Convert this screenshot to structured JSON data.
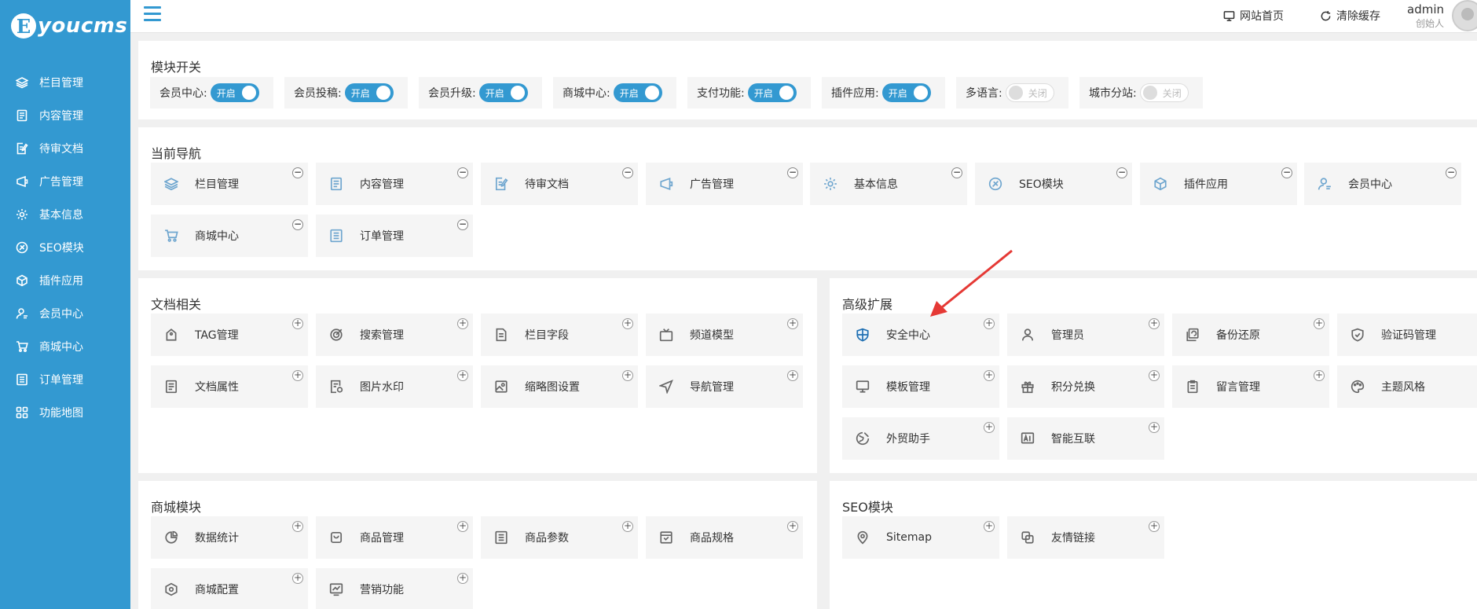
{
  "logo": {
    "letter": "E",
    "text": "youcms"
  },
  "sidebar": {
    "items": [
      {
        "label": "栏目管理",
        "icon": "layers-icon"
      },
      {
        "label": "内容管理",
        "icon": "document-icon"
      },
      {
        "label": "待审文档",
        "icon": "edit-document-icon"
      },
      {
        "label": "广告管理",
        "icon": "ad-icon"
      },
      {
        "label": "基本信息",
        "icon": "gear-icon"
      },
      {
        "label": "SEO模块",
        "icon": "seo-icon"
      },
      {
        "label": "插件应用",
        "icon": "cube-icon"
      },
      {
        "label": "会员中心",
        "icon": "user-icon"
      },
      {
        "label": "商城中心",
        "icon": "cart-icon"
      },
      {
        "label": "订单管理",
        "icon": "list-icon"
      },
      {
        "label": "功能地图",
        "icon": "grid-icon"
      }
    ]
  },
  "topbar": {
    "home_label": "网站首页",
    "clear_cache_label": "清除缓存",
    "user_name": "admin",
    "user_role": "创始人"
  },
  "modules": {
    "title": "模块开关",
    "toggles": [
      {
        "label": "会员中心:",
        "state": "开启",
        "on": true
      },
      {
        "label": "会员投稿:",
        "state": "开启",
        "on": true
      },
      {
        "label": "会员升级:",
        "state": "开启",
        "on": true
      },
      {
        "label": "商城中心:",
        "state": "开启",
        "on": true
      },
      {
        "label": "支付功能:",
        "state": "开启",
        "on": true
      },
      {
        "label": "插件应用:",
        "state": "开启",
        "on": true
      },
      {
        "label": "多语言:",
        "state": "关闭",
        "on": false
      },
      {
        "label": "城市分站:",
        "state": "关闭",
        "on": false
      }
    ]
  },
  "current_nav": {
    "title": "当前导航",
    "items": [
      {
        "label": "栏目管理",
        "icon": "layers-icon"
      },
      {
        "label": "内容管理",
        "icon": "document-icon"
      },
      {
        "label": "待审文档",
        "icon": "edit-document-icon"
      },
      {
        "label": "广告管理",
        "icon": "ad-icon"
      },
      {
        "label": "基本信息",
        "icon": "gear-icon"
      },
      {
        "label": "SEO模块",
        "icon": "seo-icon"
      },
      {
        "label": "插件应用",
        "icon": "cube-icon"
      },
      {
        "label": "会员中心",
        "icon": "user-icon"
      },
      {
        "label": "商城中心",
        "icon": "cart-icon"
      },
      {
        "label": "订单管理",
        "icon": "list-icon"
      }
    ]
  },
  "doc_related": {
    "title": "文档相关",
    "items": [
      {
        "label": "TAG管理",
        "icon": "tag-icon"
      },
      {
        "label": "搜索管理",
        "icon": "search-target-icon"
      },
      {
        "label": "栏目字段",
        "icon": "field-icon"
      },
      {
        "label": "频道模型",
        "icon": "tv-icon"
      },
      {
        "label": "文档属性",
        "icon": "document-icon"
      },
      {
        "label": "图片水印",
        "icon": "watermark-icon"
      },
      {
        "label": "缩略图设置",
        "icon": "image-icon"
      },
      {
        "label": "导航管理",
        "icon": "navigate-icon"
      }
    ]
  },
  "advanced": {
    "title": "高级扩展",
    "items": [
      {
        "label": "安全中心",
        "icon": "shield-icon"
      },
      {
        "label": "管理员",
        "icon": "user-icon"
      },
      {
        "label": "备份还原",
        "icon": "backup-icon"
      },
      {
        "label": "验证码管理",
        "icon": "verify-icon"
      },
      {
        "label": "模板管理",
        "icon": "monitor-icon"
      },
      {
        "label": "积分兑换",
        "icon": "gift-icon"
      },
      {
        "label": "留言管理",
        "icon": "message-icon"
      },
      {
        "label": "主题风格",
        "icon": "palette-icon"
      },
      {
        "label": "外贸助手",
        "icon": "globe-icon"
      },
      {
        "label": "智能互联",
        "icon": "ai-icon"
      }
    ]
  },
  "shop_module": {
    "title": "商城模块",
    "items": [
      {
        "label": "数据统计",
        "icon": "pie-chart-icon"
      },
      {
        "label": "商品管理",
        "icon": "bag-icon"
      },
      {
        "label": "商品参数",
        "icon": "list-icon"
      },
      {
        "label": "商品规格",
        "icon": "spec-icon"
      },
      {
        "label": "商城配置",
        "icon": "hex-gear-icon"
      },
      {
        "label": "营销功能",
        "icon": "trend-icon"
      }
    ]
  },
  "seo_module": {
    "title": "SEO模块",
    "items": [
      {
        "label": "Sitemap",
        "icon": "sitemap-icon"
      },
      {
        "label": "友情链接",
        "icon": "link-icon"
      }
    ]
  },
  "colors": {
    "sidebar": "#3399d1",
    "toggle_on": "#3399d1",
    "arrow": "#e53935"
  }
}
